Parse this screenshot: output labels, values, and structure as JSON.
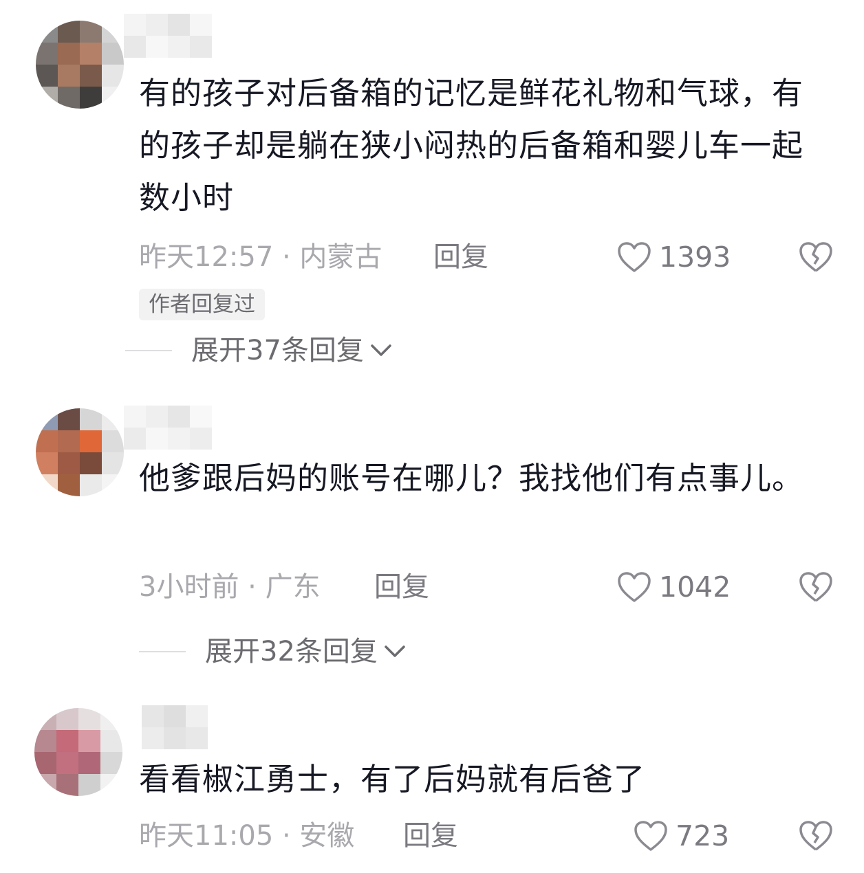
{
  "comments": [
    {
      "text": "有的孩子对后备箱的记忆是鲜花礼物和气球，有的孩子却是躺在狭小闷热的后备箱和婴儿车一起数小时",
      "time_location": "昨天12:57 · 内蒙古",
      "reply_label": "回复",
      "likes": "1393",
      "badge": "作者回复过",
      "expand_label": "展开37条回复"
    },
    {
      "text": "他爹跟后妈的账号在哪儿？我找他们有点事儿。",
      "time_location": "3小时前 · 广东",
      "reply_label": "回复",
      "likes": "1042",
      "expand_label": "展开32条回复"
    },
    {
      "text": "看看椒江勇士，有了后妈就有后爸了",
      "time_location": "昨天11:05 · 安徽",
      "reply_label": "回复",
      "likes": "723"
    }
  ],
  "icons": {
    "like": "heart-outline-icon",
    "dislike": "broken-heart-icon",
    "expand": "chevron-down-icon"
  },
  "colors": {
    "text": "#161823",
    "meta": "#a8a8ad",
    "secondary": "#7a7a80",
    "icon": "#8a8a90"
  }
}
